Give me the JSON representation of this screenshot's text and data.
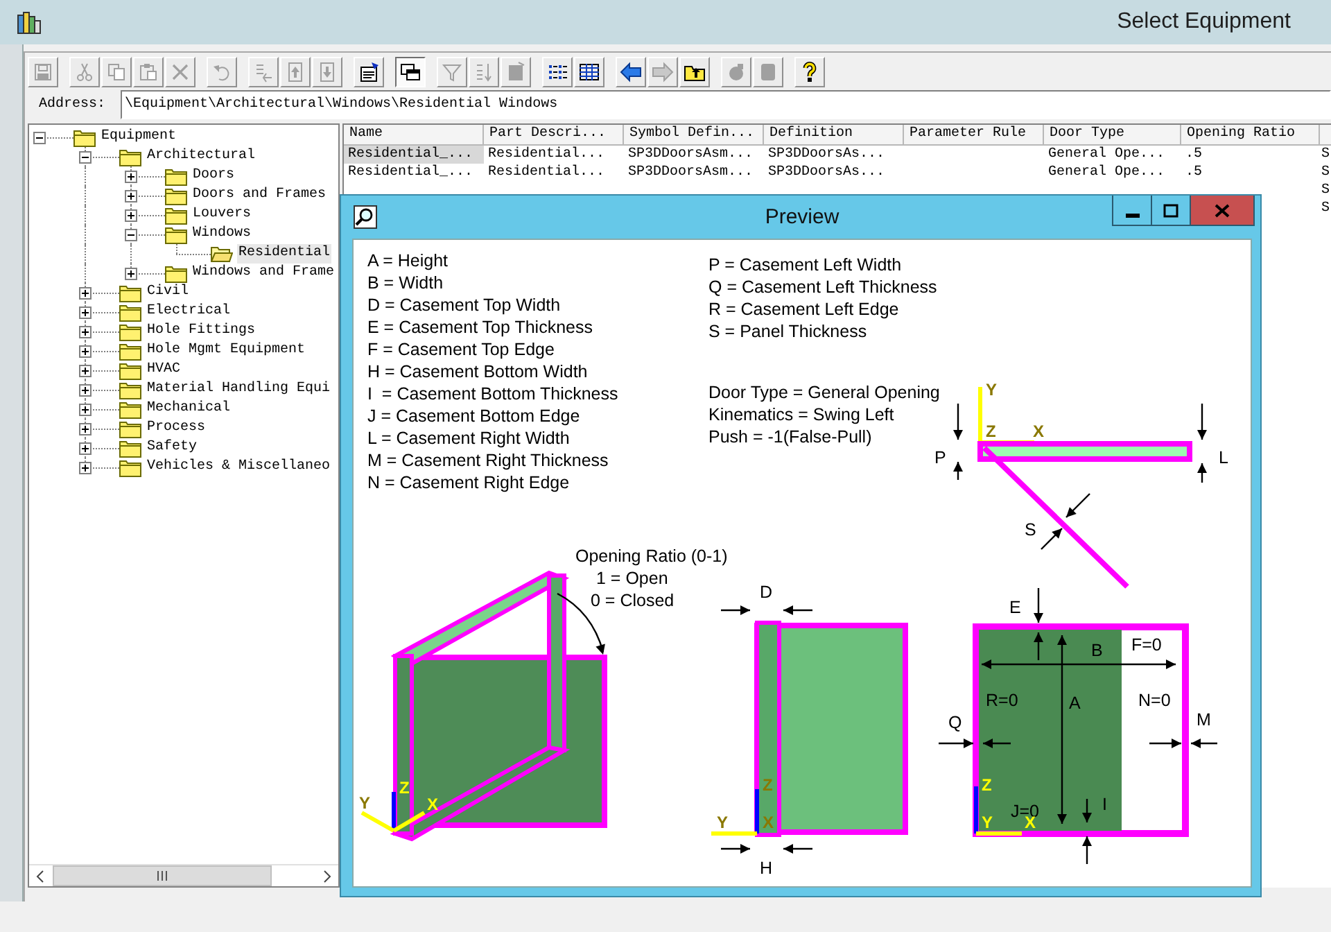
{
  "window": {
    "title": "Select Equipment"
  },
  "toolbar": {
    "groups": [
      [
        {
          "kind": "save",
          "disabled": true,
          "on": false
        }
      ],
      [
        {
          "kind": "cut",
          "disabled": true,
          "on": false
        },
        {
          "kind": "copy",
          "disabled": true,
          "on": false
        },
        {
          "kind": "paste",
          "disabled": true,
          "on": false
        },
        {
          "kind": "delete",
          "disabled": true,
          "on": false
        }
      ],
      [
        {
          "kind": "undo",
          "disabled": true,
          "on": false
        }
      ],
      [
        {
          "kind": "insert",
          "disabled": true,
          "on": false
        },
        {
          "kind": "move-up",
          "disabled": true,
          "on": false
        },
        {
          "kind": "move-down",
          "disabled": true,
          "on": false
        }
      ],
      [
        {
          "kind": "properties",
          "disabled": false,
          "on": false
        }
      ],
      [
        {
          "kind": "preview",
          "disabled": false,
          "on": true
        }
      ],
      [
        {
          "kind": "filter",
          "disabled": true,
          "on": false
        },
        {
          "kind": "sort",
          "disabled": true,
          "on": false
        },
        {
          "kind": "clear",
          "disabled": true,
          "on": false
        }
      ],
      [
        {
          "kind": "list",
          "disabled": false,
          "on": false
        },
        {
          "kind": "details",
          "disabled": false,
          "on": false
        }
      ],
      [
        {
          "kind": "back",
          "disabled": false,
          "on": false
        },
        {
          "kind": "forward",
          "disabled": true,
          "on": false
        },
        {
          "kind": "up-folder",
          "disabled": false,
          "on": false
        }
      ],
      [
        {
          "kind": "object",
          "disabled": true,
          "on": false
        },
        {
          "kind": "report",
          "disabled": true,
          "on": false
        }
      ],
      [
        {
          "kind": "help",
          "disabled": false,
          "on": false
        }
      ]
    ]
  },
  "address": {
    "label": "Address:",
    "value": "\\Equipment\\Architectural\\Windows\\Residential Windows"
  },
  "tree": [
    {
      "label": "Equipment",
      "expanded": true,
      "selected": false,
      "children": [
        {
          "label": "Architectural",
          "expanded": true,
          "selected": false,
          "children": [
            {
              "label": "Doors",
              "expanded": false,
              "selected": false
            },
            {
              "label": "Doors and Frames",
              "expanded": false,
              "selected": false
            },
            {
              "label": "Louvers",
              "expanded": false,
              "selected": false
            },
            {
              "label": "Windows",
              "expanded": true,
              "selected": false,
              "children": [
                {
                  "label": "Residential",
                  "selected": true
                }
              ]
            },
            {
              "label": "Windows and Frame",
              "expanded": false,
              "selected": false
            }
          ]
        },
        {
          "label": "Civil",
          "expanded": false,
          "selected": false
        },
        {
          "label": "Electrical",
          "expanded": false,
          "selected": false
        },
        {
          "label": "Hole Fittings",
          "expanded": false,
          "selected": false
        },
        {
          "label": "Hole Mgmt Equipment",
          "expanded": false,
          "selected": false
        },
        {
          "label": "HVAC",
          "expanded": false,
          "selected": false
        },
        {
          "label": "Material Handling Equi",
          "expanded": false,
          "selected": false
        },
        {
          "label": "Mechanical",
          "expanded": false,
          "selected": false
        },
        {
          "label": "Process",
          "expanded": false,
          "selected": false
        },
        {
          "label": "Safety",
          "expanded": false,
          "selected": false
        },
        {
          "label": "Vehicles & Miscellaneo",
          "expanded": false,
          "selected": false
        }
      ]
    }
  ],
  "table": {
    "columns": [
      "Name",
      "Part Descri...",
      "Symbol Defin...",
      "Definition",
      "Parameter Rule",
      "Door Type",
      "Opening Ratio"
    ],
    "rows": [
      {
        "selected": true,
        "name": "Residential_...",
        "part_description": "Residential...",
        "symbol_definition": "SP3DDoorsAsm...",
        "definition": "SP3DDoorsAs...",
        "door_type": "General Ope...",
        "opening_ratio": ".5",
        "column_8": "S"
      },
      {
        "selected": false,
        "name": "Residential_...",
        "part_description": "Residential...",
        "symbol_definition": "SP3DDoorsAsm...",
        "definition": "SP3DDoorsAs...",
        "door_type": "General Ope...",
        "opening_ratio": ".5",
        "column_8": "S"
      },
      {
        "column_8": "S"
      },
      {
        "column_8": "S"
      }
    ]
  },
  "preview": {
    "title": "Preview",
    "legend_left": [
      "A = Height",
      "B = Width",
      "D = Casement Top Width",
      "E = Casement Top Thickness",
      "F = Casement Top Edge",
      "H = Casement Bottom Width",
      "I  = Casement Bottom Thickness",
      "J = Casement Bottom Edge",
      "L = Casement Right Width",
      "M = Casement Right Thickness",
      "N = Casement Right Edge"
    ],
    "legend_right": [
      "P = Casement Left Width",
      "Q = Casement Left Thickness",
      "R = Casement Left Edge",
      "S = Panel Thickness"
    ],
    "info": [
      "Door Type = General Opening",
      "Kinematics = Swing Left",
      "Push = -1(False-Pull)"
    ],
    "plan_view": {
      "labels": [
        "P",
        "L",
        "S"
      ],
      "axes": [
        "Y",
        "Z",
        "X"
      ]
    },
    "iso_view": {
      "notes": [
        "Opening Ratio (0-1)",
        "1 = Open",
        "0 = Closed"
      ],
      "axes": [
        "Z",
        "Y",
        "X"
      ]
    },
    "side_view": {
      "labels": [
        "D",
        "H"
      ],
      "axes": [
        "Z",
        "Y",
        "X"
      ]
    },
    "front_view": {
      "labels": [
        "E",
        "B",
        "F=0",
        "R=0",
        "A",
        "N=0",
        "Q",
        "M",
        "J=0",
        "I"
      ],
      "axes": [
        "Z",
        "Y",
        "X"
      ]
    }
  }
}
